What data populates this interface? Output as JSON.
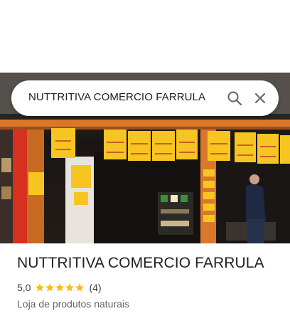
{
  "search": {
    "query": "NUTTRITIVA COMERCIO FARRULA"
  },
  "place": {
    "name": "NUTTRITIVA COMERCIO FARRULA",
    "rating": "5,0",
    "stars": 5,
    "review_count": "(4)",
    "category": "Loja de produtos naturais"
  },
  "colors": {
    "star": "#fbbc04",
    "text_primary": "#202124",
    "text_secondary": "#5f6368",
    "price_tag": "#f7c522"
  },
  "icons": {
    "search": "search-icon",
    "close": "close-icon",
    "star": "star-icon"
  }
}
